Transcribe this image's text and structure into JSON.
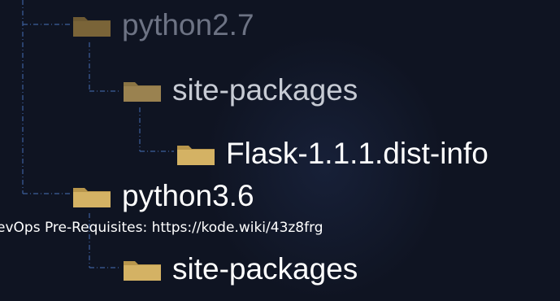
{
  "tree": {
    "nodes": [
      {
        "label": "python2.7",
        "icon": "folder-icon"
      },
      {
        "label": "site-packages",
        "icon": "folder-icon"
      },
      {
        "label": "Flask-1.1.1.dist-info",
        "icon": "folder-icon"
      },
      {
        "label": "python3.6",
        "icon": "folder-icon"
      },
      {
        "label": "site-packages",
        "icon": "folder-icon"
      }
    ]
  },
  "caption": "evOps Pre-Requisites: https://kode.wiki/43z8frg",
  "colors": {
    "background": "#0f1422",
    "folder": "#c9a85a",
    "line": "#3c5f9c",
    "dim_text": "#6d7384"
  }
}
